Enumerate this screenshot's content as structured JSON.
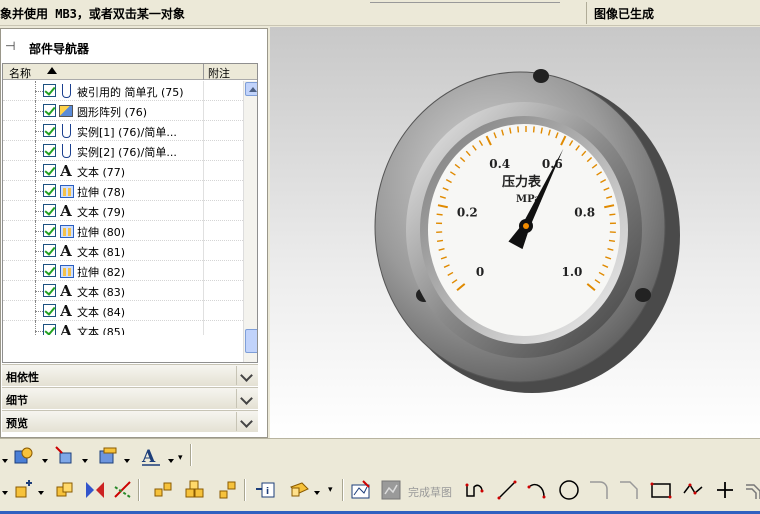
{
  "status": {
    "prompt": "象并使用 MB3，或者双击某一对象",
    "message": "图像已生成"
  },
  "navigator": {
    "title": "部件导航器",
    "col_name": "名称",
    "col_notes": "附注",
    "rows": [
      {
        "icon": "hole-icon",
        "label": "被引用的 简单孔 (75)"
      },
      {
        "icon": "circular-pattern-icon",
        "label": "圆形阵列 (76)"
      },
      {
        "icon": "hole-icon",
        "label": "实例[1] (76)/简单..."
      },
      {
        "icon": "hole-icon",
        "label": "实例[2] (76)/简单..."
      },
      {
        "icon": "text-icon",
        "label": "文本 (77)"
      },
      {
        "icon": "extrude-icon",
        "label": "拉伸 (78)"
      },
      {
        "icon": "text-icon",
        "label": "文本 (79)"
      },
      {
        "icon": "extrude-icon",
        "label": "拉伸 (80)"
      },
      {
        "icon": "text-icon",
        "label": "文本 (81)"
      },
      {
        "icon": "extrude-icon",
        "label": "拉伸 (82)"
      },
      {
        "icon": "text-icon",
        "label": "文本 (83)"
      },
      {
        "icon": "text-icon",
        "label": "文本 (84)"
      },
      {
        "icon": "text-icon",
        "label": "文本 (85)"
      }
    ],
    "sections": [
      "相依性",
      "细节",
      "预览"
    ]
  },
  "gauge": {
    "title": "压力表",
    "unit": "MPa",
    "ticks": [
      "0",
      "0.2",
      "0.4",
      "0.6",
      "0.8",
      "1.0"
    ],
    "value": 0.61
  },
  "toolbar": {
    "finish_sketch_label": "完成草图"
  }
}
